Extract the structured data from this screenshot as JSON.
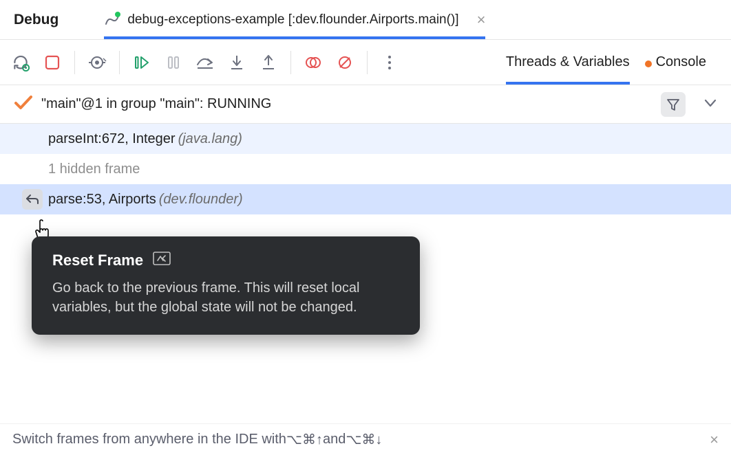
{
  "header": {
    "title": "Debug",
    "run_tab_label": "debug-exceptions-example [:dev.flounder.Airports.main()]"
  },
  "right_tabs": {
    "threads": "Threads & Variables",
    "console": "Console"
  },
  "thread": {
    "label": "\"main\"@1 in group \"main\": RUNNING"
  },
  "frames": [
    {
      "method": "parseInt:672, Integer",
      "package": "(java.lang)"
    },
    {
      "method": "1 hidden frame",
      "package": ""
    },
    {
      "method": "parse:53, Airports",
      "package": "(dev.flounder)"
    }
  ],
  "tooltip": {
    "title": "Reset Frame",
    "body": "Go back to the previous frame. This will reset local variables, but the global state will not be changed."
  },
  "hint": {
    "text_prefix": "Switch frames from anywhere in the IDE with ",
    "shortcut_up": "⌥⌘↑",
    "text_mid": " and ",
    "shortcut_down": "⌥⌘↓"
  }
}
